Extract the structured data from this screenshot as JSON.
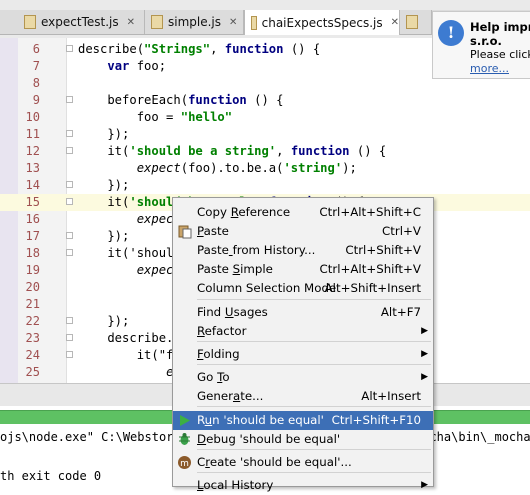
{
  "tabs": [
    {
      "label": "expectTest.js",
      "active": false
    },
    {
      "label": "simple.js",
      "active": false
    },
    {
      "label": "chaiExpectsSpecs.js",
      "active": true
    }
  ],
  "code_lines": [
    {
      "num": "6",
      "text": "describe(\"Strings\", function () {"
    },
    {
      "num": "7",
      "text": "    var foo;"
    },
    {
      "num": "8",
      "text": ""
    },
    {
      "num": "9",
      "text": "    beforeEach(function () {"
    },
    {
      "num": "10",
      "text": "        foo = \"hello\""
    },
    {
      "num": "11",
      "text": "    });"
    },
    {
      "num": "12",
      "text": "    it('should be a string', function () {"
    },
    {
      "num": "13",
      "text": "        expect(foo).to.be.a('string');"
    },
    {
      "num": "14",
      "text": "    });"
    },
    {
      "num": "15",
      "text": "    it('should be equal', function () {"
    },
    {
      "num": "16",
      "text": "        expect(f"
    },
    {
      "num": "17",
      "text": "    });"
    },
    {
      "num": "18",
      "text": "    it('should"
    },
    {
      "num": "19",
      "text": "        expect(f"
    },
    {
      "num": "20",
      "text": ""
    },
    {
      "num": "21",
      "text": ""
    },
    {
      "num": "22",
      "text": "    });"
    },
    {
      "num": "23",
      "text": "    describe.s"
    },
    {
      "num": "24",
      "text": "        it(\"foo"
    },
    {
      "num": "25",
      "text": "            expect"
    }
  ],
  "notification": {
    "title_1": "Help impro",
    "title_2": "s.r.o.",
    "body_prefix": "Please click ",
    "body_link": "I",
    "more_link": "more..."
  },
  "console": {
    "line_1": "ojs\\node.exe\" C:\\Webstor",
    "line_1_tail": "mocha\\bin\\_mocha",
    "line_2": "th exit code 0"
  },
  "context_menu": {
    "items": [
      {
        "label": "Copy Reference",
        "shortcut": "Ctrl+Alt+Shift+C",
        "submenu": false
      },
      {
        "label": "Paste",
        "shortcut": "Ctrl+V",
        "submenu": false,
        "icon": "paste-icon"
      },
      {
        "label": "Paste from History...",
        "shortcut": "Ctrl+Shift+V",
        "submenu": false
      },
      {
        "label": "Paste Simple",
        "shortcut": "Ctrl+Alt+Shift+V",
        "submenu": false
      },
      {
        "label": "Column Selection Mode",
        "shortcut": "Alt+Shift+Insert",
        "submenu": false
      },
      {
        "label": "Find Usages",
        "shortcut": "Alt+F7",
        "submenu": false
      },
      {
        "label": "Refactor",
        "shortcut": "",
        "submenu": true
      },
      {
        "label": "Folding",
        "shortcut": "",
        "submenu": true
      },
      {
        "label": "Go To",
        "shortcut": "",
        "submenu": true
      },
      {
        "label": "Generate...",
        "shortcut": "Alt+Insert",
        "submenu": false
      },
      {
        "label": "Run 'should be equal'",
        "shortcut": "Ctrl+Shift+F10",
        "submenu": false,
        "selected": true,
        "icon": "run-icon"
      },
      {
        "label": "Debug 'should be equal'",
        "shortcut": "",
        "submenu": false,
        "icon": "debug-icon"
      },
      {
        "label": "Create 'should be equal'...",
        "shortcut": "",
        "submenu": false,
        "icon": "mocha-icon"
      },
      {
        "label": "Local History",
        "shortcut": "",
        "submenu": true
      }
    ]
  },
  "colors": {
    "selection": "#3d6fb6",
    "progress": "#5ec163",
    "current_line": "#fcfadf"
  }
}
